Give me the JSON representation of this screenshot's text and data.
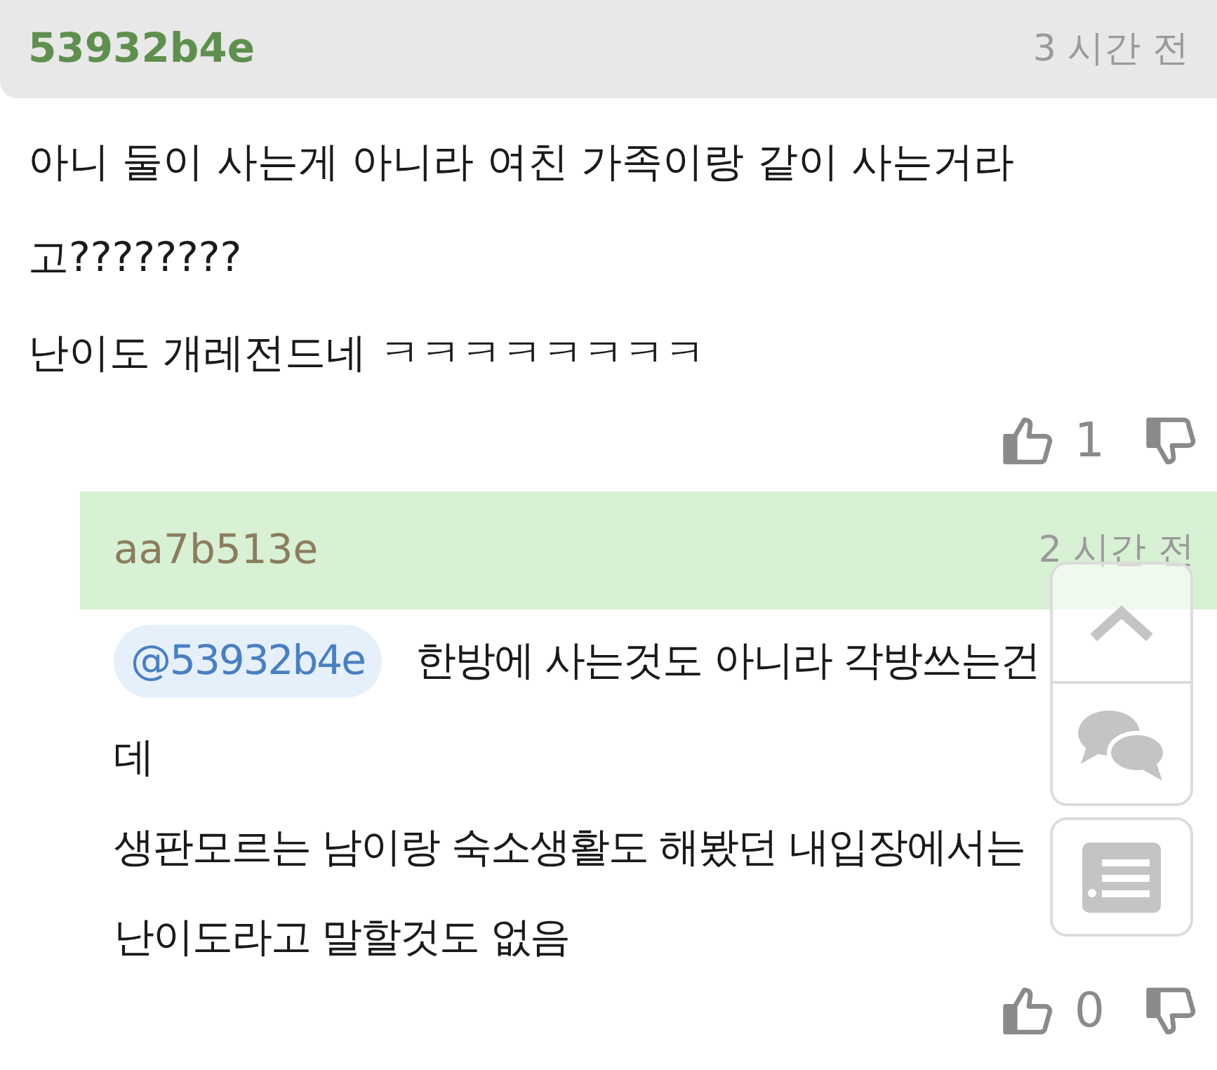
{
  "comment": {
    "author": "53932b4e",
    "time": "3 시간 전",
    "lines": [
      "아니 둘이 사는게 아니라 여친 가족이랑 같이 사는거라",
      "고????????",
      "난이도 개레전드네 ㅋㅋㅋㅋㅋㅋㅋㅋ"
    ],
    "likes": "1"
  },
  "reply": {
    "author": "aa7b513e",
    "time": "2 시간 전",
    "mention": "@53932b4e",
    "lines": [
      "한방에 사는것도 아니라 각방쓰는건",
      "데",
      "생판모르는 남이랑 숙소생활도 해봤던 내입장에서는",
      "난이도라고 말할것도 없음"
    ],
    "likes": "0"
  }
}
